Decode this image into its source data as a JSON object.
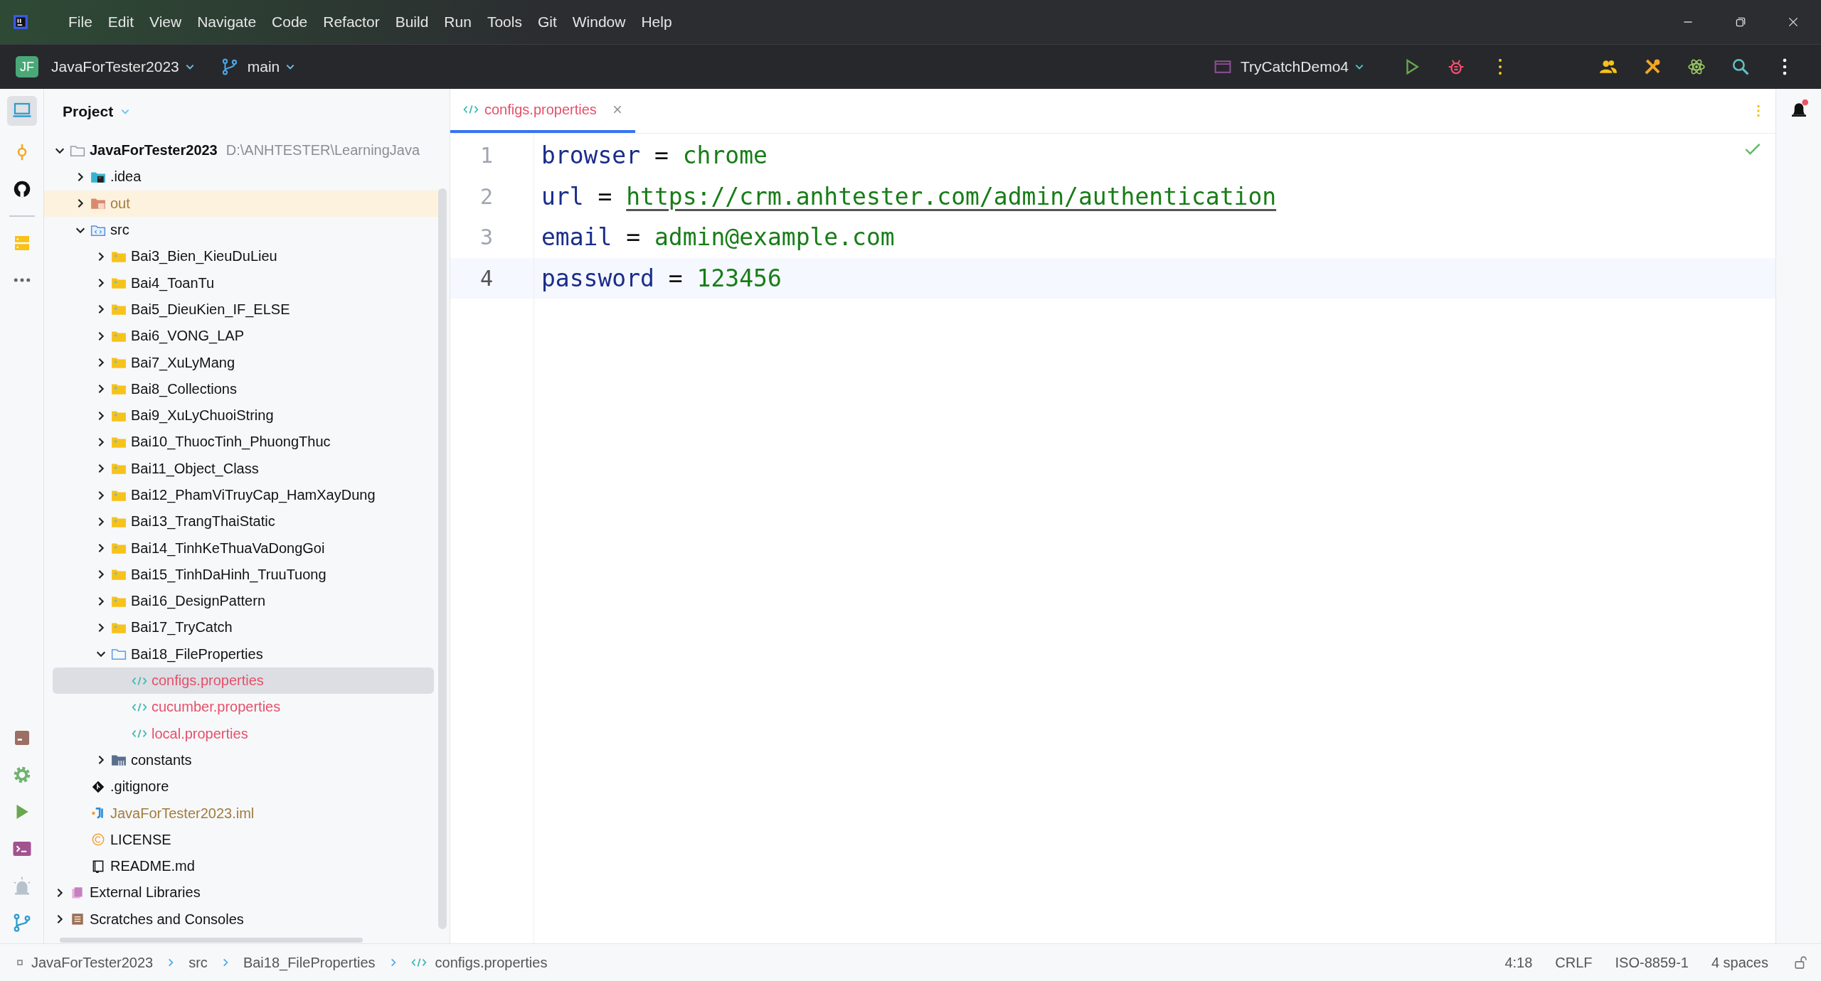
{
  "menu": [
    {
      "label": "File"
    },
    {
      "label": "Edit"
    },
    {
      "label": "View"
    },
    {
      "label": "Navigate"
    },
    {
      "label": "Code"
    },
    {
      "label": "Refactor"
    },
    {
      "label": "Build"
    },
    {
      "label": "Run"
    },
    {
      "label": "Tools"
    },
    {
      "label": "Git"
    },
    {
      "label": "Window"
    },
    {
      "label": "Help"
    }
  ],
  "toolbar": {
    "project_badge": "JF",
    "project": "JavaForTester2023",
    "branch": "main",
    "run_config": "TryCatchDemo4"
  },
  "project_panel": {
    "title": "Project",
    "tree": [
      {
        "label": "JavaForTester2023",
        "hint": "D:\\ANHTESTER\\LearningJava",
        "kind": "project",
        "expanded": true,
        "selected": false,
        "untracked": false,
        "ignored": false,
        "children": [
          {
            "label": ".idea",
            "kind": "idea",
            "expanded": false,
            "selected": false,
            "untracked": false,
            "ignored": false
          },
          {
            "label": "out",
            "kind": "out",
            "expanded": false,
            "selected": false,
            "untracked": false,
            "ignored": true
          },
          {
            "label": "src",
            "kind": "src",
            "expanded": true,
            "selected": false,
            "untracked": false,
            "ignored": false,
            "children": [
              {
                "label": "Bai3_Bien_KieuDuLieu",
                "kind": "package",
                "expanded": false,
                "selected": false,
                "untracked": false,
                "ignored": false
              },
              {
                "label": "Bai4_ToanTu",
                "kind": "package",
                "expanded": false,
                "selected": false,
                "untracked": false,
                "ignored": false
              },
              {
                "label": "Bai5_DieuKien_IF_ELSE",
                "kind": "package",
                "expanded": false,
                "selected": false,
                "untracked": false,
                "ignored": false
              },
              {
                "label": "Bai6_VONG_LAP",
                "kind": "package",
                "expanded": false,
                "selected": false,
                "untracked": false,
                "ignored": false
              },
              {
                "label": "Bai7_XuLyMang",
                "kind": "package",
                "expanded": false,
                "selected": false,
                "untracked": false,
                "ignored": false
              },
              {
                "label": "Bai8_Collections",
                "kind": "package",
                "expanded": false,
                "selected": false,
                "untracked": false,
                "ignored": false
              },
              {
                "label": "Bai9_XuLyChuoiString",
                "kind": "package",
                "expanded": false,
                "selected": false,
                "untracked": false,
                "ignored": false
              },
              {
                "label": "Bai10_ThuocTinh_PhuongThuc",
                "kind": "package",
                "expanded": false,
                "selected": false,
                "untracked": false,
                "ignored": false
              },
              {
                "label": "Bai11_Object_Class",
                "kind": "package",
                "expanded": false,
                "selected": false,
                "untracked": false,
                "ignored": false
              },
              {
                "label": "Bai12_PhamViTruyCap_HamXayDung",
                "kind": "package",
                "expanded": false,
                "selected": false,
                "untracked": false,
                "ignored": false
              },
              {
                "label": "Bai13_TrangThaiStatic",
                "kind": "package",
                "expanded": false,
                "selected": false,
                "untracked": false,
                "ignored": false
              },
              {
                "label": "Bai14_TinhKeThuaVaDongGoi",
                "kind": "package",
                "expanded": false,
                "selected": false,
                "untracked": false,
                "ignored": false
              },
              {
                "label": "Bai15_TinhDaHinh_TruuTuong",
                "kind": "package",
                "expanded": false,
                "selected": false,
                "untracked": false,
                "ignored": false
              },
              {
                "label": "Bai16_DesignPattern",
                "kind": "package",
                "expanded": false,
                "selected": false,
                "untracked": false,
                "ignored": false
              },
              {
                "label": "Bai17_TryCatch",
                "kind": "package",
                "expanded": false,
                "selected": false,
                "untracked": false,
                "ignored": false
              },
              {
                "label": "Bai18_FileProperties",
                "kind": "folder",
                "expanded": true,
                "selected": false,
                "untracked": false,
                "ignored": false,
                "children": [
                  {
                    "label": "configs.properties",
                    "kind": "properties",
                    "selected": true,
                    "untracked": true,
                    "ignored": false
                  },
                  {
                    "label": "cucumber.properties",
                    "kind": "properties",
                    "selected": false,
                    "untracked": true,
                    "ignored": false
                  },
                  {
                    "label": "local.properties",
                    "kind": "properties",
                    "selected": false,
                    "untracked": true,
                    "ignored": false
                  }
                ]
              },
              {
                "label": "constants",
                "kind": "constants",
                "expanded": false,
                "selected": false,
                "untracked": false,
                "ignored": false
              }
            ]
          },
          {
            "label": ".gitignore",
            "kind": "gitignore",
            "selected": false,
            "untracked": false,
            "ignored": false
          },
          {
            "label": "JavaForTester2023.iml",
            "kind": "iml",
            "selected": false,
            "untracked": false,
            "ignored": true
          },
          {
            "label": "LICENSE",
            "kind": "license",
            "selected": false,
            "untracked": false,
            "ignored": false
          },
          {
            "label": "README.md",
            "kind": "readme",
            "selected": false,
            "untracked": false,
            "ignored": false
          }
        ]
      },
      {
        "label": "External Libraries",
        "kind": "libraries",
        "expanded": false,
        "selected": false,
        "untracked": false,
        "ignored": false
      },
      {
        "label": "Scratches and Consoles",
        "kind": "scratches",
        "expanded": false,
        "selected": false,
        "untracked": false,
        "ignored": false
      }
    ]
  },
  "editor": {
    "tabs": [
      {
        "label": "configs.properties",
        "selected": true,
        "untracked": true
      }
    ],
    "lines": [
      {
        "number": "1",
        "key": "browser",
        "sep": "=",
        "value": "chrome",
        "kind": "text",
        "current": false
      },
      {
        "number": "2",
        "key": "url",
        "sep": "=",
        "value": "https://crm.anhtester.com/admin/authentication",
        "kind": "link",
        "current": false
      },
      {
        "number": "3",
        "key": "email",
        "sep": "=",
        "value": "admin@example.com",
        "kind": "text",
        "current": false
      },
      {
        "number": "4",
        "key": "password",
        "sep": "=",
        "value": "123456",
        "kind": "text",
        "current": true
      }
    ]
  },
  "status_bar": {
    "breadcrumbs": [
      {
        "label": "JavaForTester2023",
        "kind": "module"
      },
      {
        "label": "src",
        "kind": "folder"
      },
      {
        "label": "Bai18_FileProperties",
        "kind": "folder"
      },
      {
        "label": "configs.properties",
        "kind": "properties"
      }
    ],
    "position": "4:18",
    "line_separator": "CRLF",
    "encoding": "ISO-8859-1",
    "indent": "4 spaces"
  }
}
